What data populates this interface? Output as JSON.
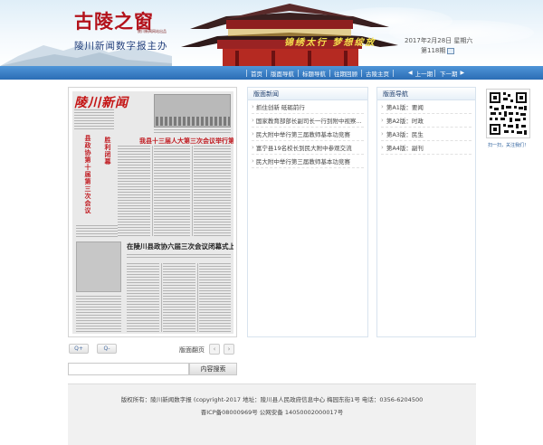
{
  "header": {
    "logo_text": "古陵之窗",
    "logo_subtitle": "陵川新闻网站出品",
    "site_title": "陵川新闻数字报主办",
    "slogan": "锦绣太行  梦想绽放",
    "date": "2017年2月28日 星期六",
    "issue": "第118期"
  },
  "nav": {
    "links": [
      "首页",
      "版面导航",
      "标题导航",
      "往期回顾",
      "古陵主页"
    ],
    "prev_page": "上一期",
    "next_page": "下一期"
  },
  "paper": {
    "masthead": "陵川新闻",
    "headline_main": "我县十三届人大第三次会议举行第二次大会",
    "vertical_head_1": "县政协第十届第三次会议",
    "vertical_head_2": "胜利闭幕",
    "headline_secondary": "在陵川县政协六届三次会议闭幕式上的讲话"
  },
  "tools": {
    "zoom_in_label": "Q+",
    "zoom_out_label": "Q-",
    "page_turn_label": "版面翻页",
    "prev_arrow": "‹",
    "next_arrow": "›",
    "search_placeholder": "",
    "search_button": "内容搜索"
  },
  "news_column": {
    "title": "版面新闻",
    "items": [
      "抓住创新 砥砺前行",
      "国家教育部部长副司长一行到附中视察...",
      "民大附中举行第三届教师基本功竞赛",
      "富宁县19名校长到民大附中参观交流",
      "民大附中举行第三届教师基本功竞赛"
    ]
  },
  "page_nav_column": {
    "title": "版面导航",
    "items": [
      "第A1版：要闻",
      "第A2版：时政",
      "第A3版：民生",
      "第A4版：副刊"
    ]
  },
  "qr": {
    "caption": "扫一扫，关注我们！"
  },
  "footer": {
    "line1": "版权所有：陵川新闻数字报  (copyright-2017  地址：陵川县人民政府信息中心  梅园东街1号   电话：0356-6204500",
    "line2": "晋ICP备08000969号    公网安备 14050002000017号"
  },
  "colors": {
    "nav_blue": "#3a7fc6",
    "logo_red": "#b3121b",
    "headline_red": "#c0191f",
    "title_blue": "#1f3c7a"
  }
}
